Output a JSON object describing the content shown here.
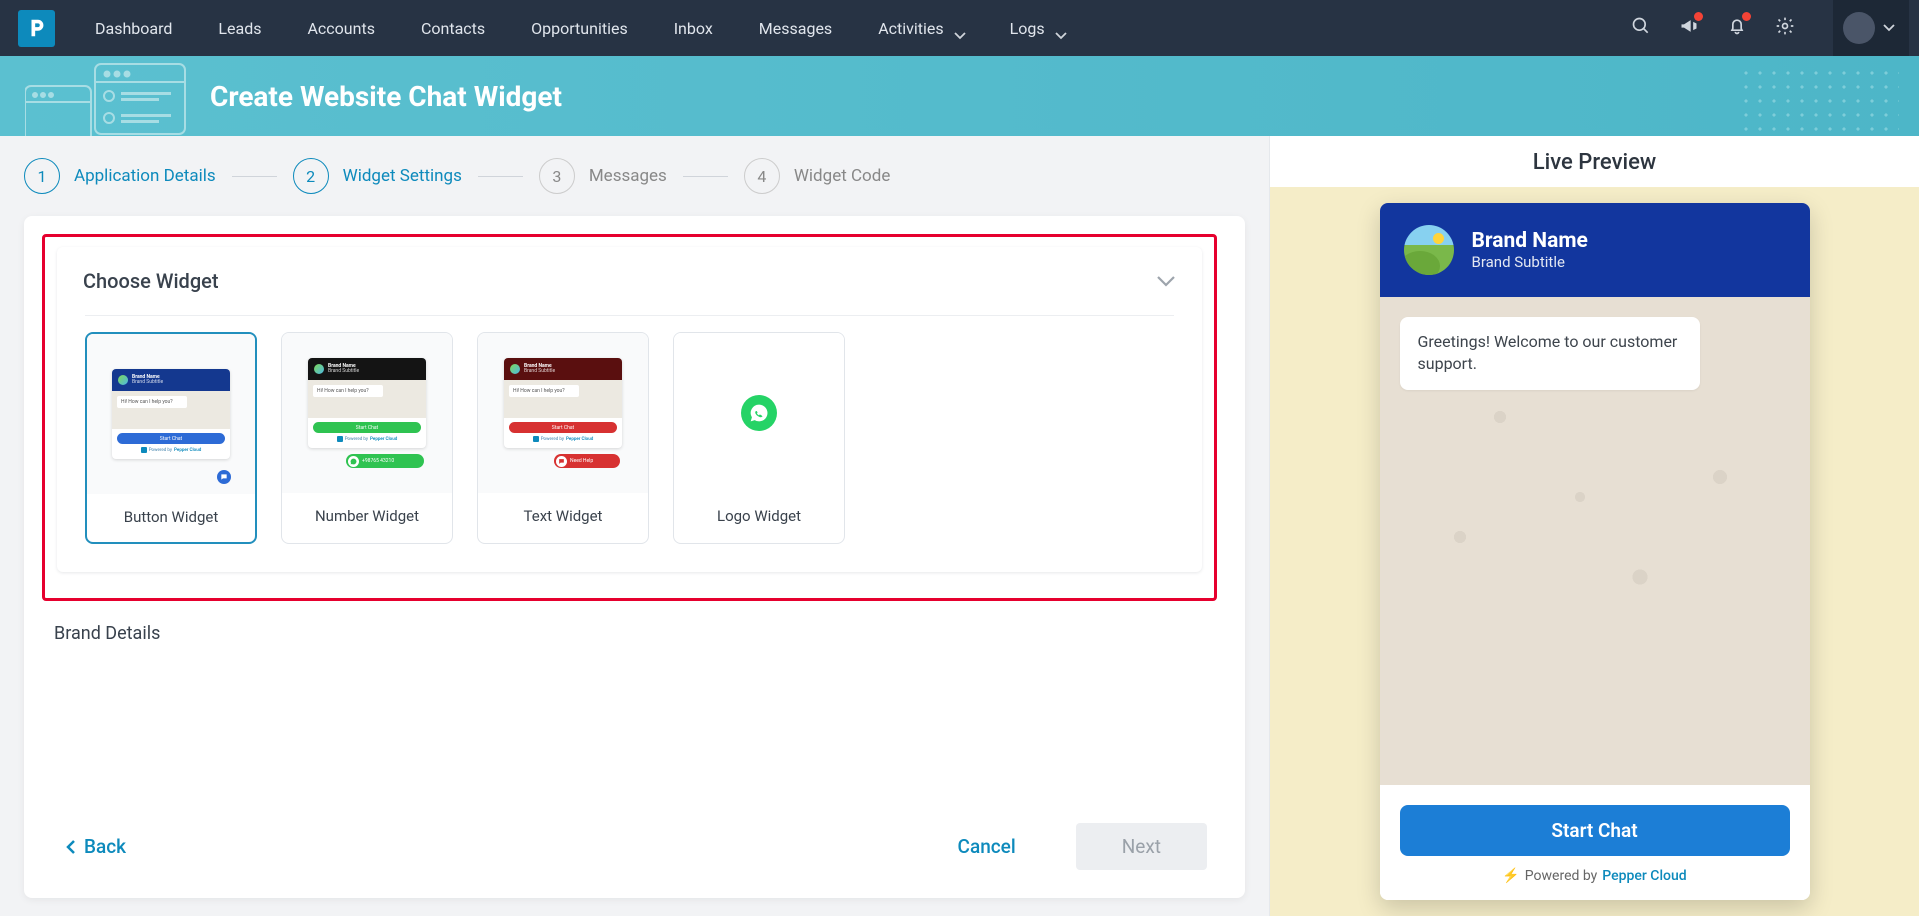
{
  "nav": {
    "items": [
      "Dashboard",
      "Leads",
      "Accounts",
      "Contacts",
      "Opportunities",
      "Inbox",
      "Messages",
      "Activities",
      "Logs"
    ]
  },
  "banner": {
    "title": "Create Website Chat Widget"
  },
  "stepper": {
    "steps": [
      {
        "num": "1",
        "label": "Application Details"
      },
      {
        "num": "2",
        "label": "Widget Settings"
      },
      {
        "num": "3",
        "label": "Messages"
      },
      {
        "num": "4",
        "label": "Widget Code"
      }
    ]
  },
  "section": {
    "title": "Choose Widget"
  },
  "widgets": {
    "options": [
      "Button Widget",
      "Number Widget",
      "Text Widget",
      "Logo Widget"
    ],
    "mini": {
      "brand": "Brand Name",
      "sub": "Brand Subtitle",
      "bubble": "Hi! How can I help you?",
      "start": "Start Chat",
      "powered": "Powered by",
      "pc": "Pepper Cloud",
      "number": "+98765 43210",
      "needhelp": "Need Help"
    }
  },
  "next_section": "Brand Details",
  "buttons": {
    "back": "Back",
    "cancel": "Cancel",
    "next": "Next"
  },
  "preview": {
    "title": "Live Preview",
    "brand": "Brand Name",
    "sub": "Brand Subtitle",
    "greeting": "Greetings! Welcome to our customer support.",
    "start": "Start Chat",
    "powered": "Powered by",
    "pc": "Pepper Cloud"
  }
}
